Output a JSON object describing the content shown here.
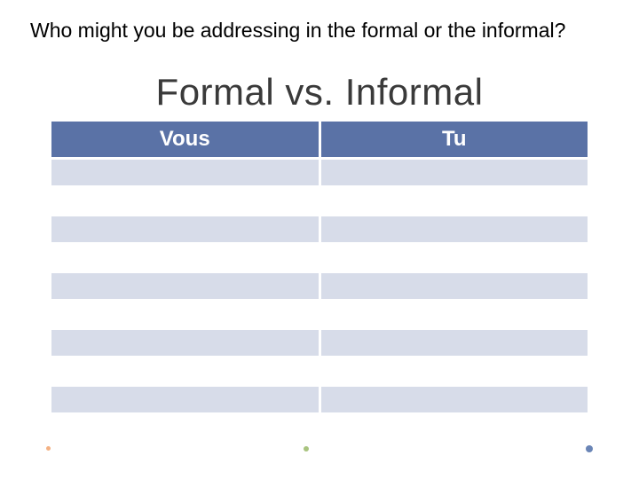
{
  "prompt": "Who might you be addressing in the formal or the informal?",
  "title": "Formal vs. Informal",
  "table": {
    "headers": [
      "Vous",
      "Tu"
    ],
    "rows": [
      [
        "",
        ""
      ],
      [
        "",
        ""
      ],
      [
        "",
        ""
      ],
      [
        "",
        ""
      ],
      [
        "",
        ""
      ],
      [
        "",
        ""
      ],
      [
        "",
        ""
      ],
      [
        "",
        ""
      ],
      [
        "",
        ""
      ]
    ]
  },
  "accent_colors": {
    "header_bg": "#5a72a6",
    "light_row": "#d7dce9",
    "dot_orange": "#f4b183",
    "dot_green": "#a9c47f",
    "dot_blue": "#6a85b6"
  }
}
